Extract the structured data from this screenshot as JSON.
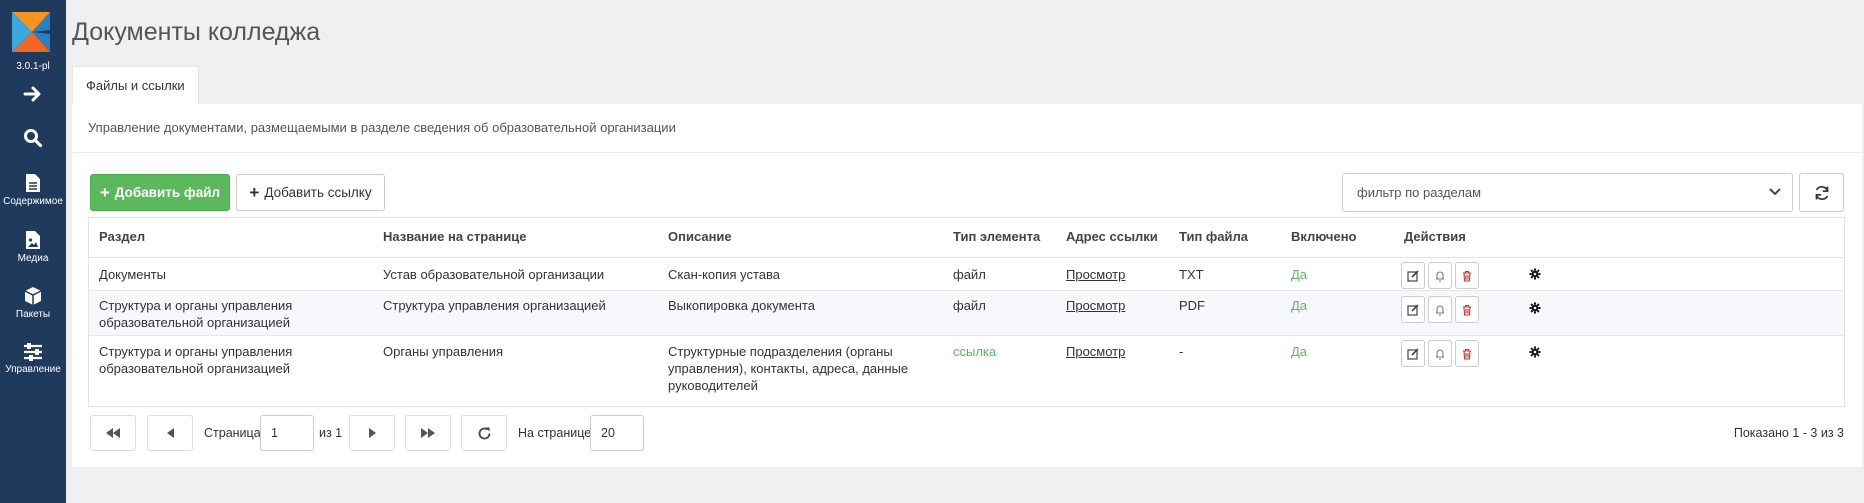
{
  "app": {
    "version": "3.0.1-pl"
  },
  "sidebar": {
    "items": [
      {
        "icon": "arrow-right-icon",
        "label": ""
      },
      {
        "icon": "search-icon",
        "label": ""
      },
      {
        "icon": "file-icon",
        "label": "Содержимое"
      },
      {
        "icon": "image-file-icon",
        "label": "Медиа"
      },
      {
        "icon": "cube-icon",
        "label": "Пакеты"
      },
      {
        "icon": "sliders-icon",
        "label": "Управление"
      }
    ]
  },
  "page": {
    "title": "Документы колледжа",
    "tab": "Файлы и ссылки",
    "description": "Управление документами, размещаемыми в разделе сведения об образовательной организации"
  },
  "toolbar": {
    "add_file": "Добавить файл",
    "add_link": "Добавить ссылку",
    "filter_placeholder": "фильтр по разделам"
  },
  "table": {
    "headers": [
      "Раздел",
      "Название на странице",
      "Описание",
      "Тип элемента",
      "Адрес ссылки",
      "Тип файла",
      "Включено",
      "Действия"
    ],
    "rows": [
      {
        "section": "Документы",
        "name": "Устав образовательной организации",
        "description": "Скан-копия устава",
        "type": "файл",
        "link": "Просмотр",
        "file_type": "TXT",
        "enabled": "Да"
      },
      {
        "section": "Структура и органы управления образовательной организацией",
        "name": "Структура управления организацией",
        "description": "Выкопировка документа",
        "type": "файл",
        "link": "Просмотр",
        "file_type": "PDF",
        "enabled": "Да"
      },
      {
        "section": "Структура и органы управления образовательной организацией",
        "name": "Органы управления",
        "description": "Структурные подразделения (органы управления), контакты, адреса, данные руководителей",
        "type": "ссылка",
        "link": "Просмотр",
        "file_type": "-",
        "enabled": "Да"
      }
    ]
  },
  "pager": {
    "page_label": "Страница",
    "page_value": "1",
    "of_label": "из 1",
    "per_page_label": "На странице:",
    "per_page_value": "20",
    "summary": "Показано 1 - 3 из 3"
  },
  "colors": {
    "sidebar": "#1f3a5c",
    "primary_green": "#5cb85c"
  }
}
